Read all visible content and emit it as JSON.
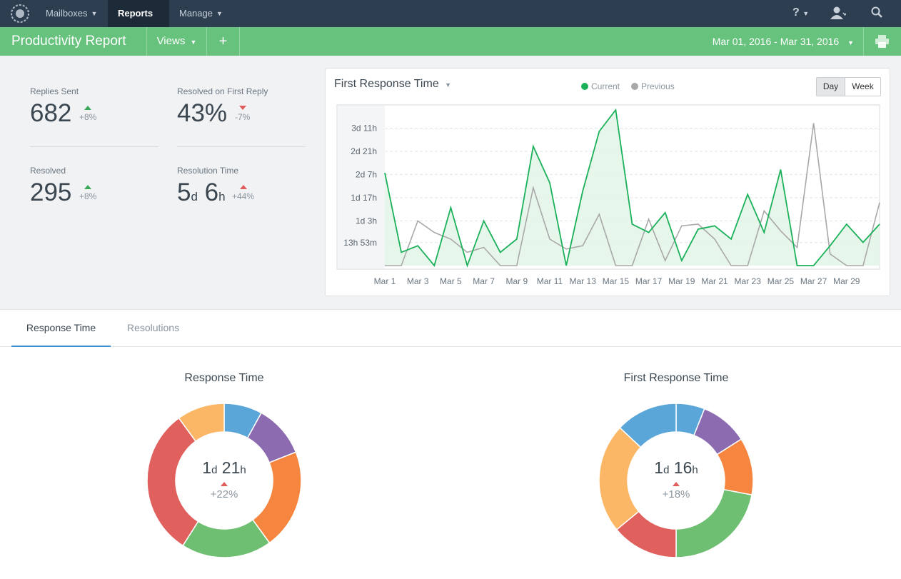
{
  "nav": {
    "mailboxes": "Mailboxes",
    "reports": "Reports",
    "manage": "Manage",
    "help_icon": "question-icon",
    "user_icon": "user-icon",
    "search_icon": "search-icon"
  },
  "subbar": {
    "title": "Productivity Report",
    "views": "Views",
    "add": "+",
    "date_range": "Mar 01, 2016 - Mar 31, 2016",
    "print_icon": "print-icon"
  },
  "stats": [
    {
      "label": "Replies Sent",
      "value": "682",
      "delta": "+8%",
      "trend": "up-good"
    },
    {
      "label": "Resolved on First Reply",
      "value": "43%",
      "delta": "-7%",
      "trend": "down-bad"
    },
    {
      "label": "Resolved",
      "value": "295",
      "delta": "+8%",
      "trend": "up-good"
    },
    {
      "label": "Resolution Time",
      "value_days": "5",
      "unit_d": "d",
      "value_hours": "6",
      "unit_h": "h",
      "delta": "+44%",
      "trend": "up-bad"
    }
  ],
  "chart": {
    "title": "First Response Time",
    "legend_current": "Current",
    "legend_previous": "Previous",
    "day": "Day",
    "week": "Week",
    "colors": {
      "current": "#1bb15a",
      "previous": "#a8a8a8",
      "fill": "#e3f4e8"
    }
  },
  "chart_data": {
    "type": "line",
    "x": [
      "Mar 1",
      "Mar 2",
      "Mar 3",
      "Mar 4",
      "Mar 5",
      "Mar 6",
      "Mar 7",
      "Mar 8",
      "Mar 9",
      "Mar 10",
      "Mar 11",
      "Mar 12",
      "Mar 13",
      "Mar 14",
      "Mar 15",
      "Mar 16",
      "Mar 17",
      "Mar 18",
      "Mar 19",
      "Mar 20",
      "Mar 21",
      "Mar 22",
      "Mar 23",
      "Mar 24",
      "Mar 25",
      "Mar 26",
      "Mar 27",
      "Mar 28",
      "Mar 29",
      "Mar 30",
      "Mar 31"
    ],
    "x_tick_labels": [
      "Mar 1",
      "Mar 3",
      "Mar 5",
      "Mar 7",
      "Mar 9",
      "Mar 11",
      "Mar 13",
      "Mar 15",
      "Mar 17",
      "Mar 19",
      "Mar 21",
      "Mar 23",
      "Mar 25",
      "Mar 27",
      "Mar 29"
    ],
    "y_tick_labels": [
      "13h 53m",
      "1d 3h",
      "1d 17h",
      "2d 7h",
      "2d 21h",
      "3d 11h"
    ],
    "y_tick_values": [
      13.88,
      27,
      41,
      55,
      69,
      83
    ],
    "ylim": [
      0,
      97
    ],
    "series": [
      {
        "name": "Current",
        "values": [
          56,
          8,
          12,
          0,
          35,
          0,
          27,
          8,
          16,
          72,
          50,
          0,
          45,
          81,
          94,
          25,
          20,
          32,
          3,
          22,
          24,
          16,
          43,
          20,
          58,
          0,
          0,
          12,
          25,
          14,
          25
        ]
      },
      {
        "name": "Previous",
        "values": [
          0,
          0,
          27,
          20,
          16,
          8,
          11,
          0,
          0,
          47,
          16,
          10,
          12,
          31,
          0,
          0,
          28,
          3,
          24,
          25,
          16,
          0,
          0,
          33,
          21,
          11,
          86,
          7,
          0,
          0,
          38
        ]
      }
    ]
  },
  "tabs": {
    "response_time": "Response Time",
    "resolutions": "Resolutions"
  },
  "donuts": [
    {
      "title": "Response Time",
      "value_days": "1",
      "unit_d": "d",
      "value_hours": "21",
      "unit_h": "h",
      "delta": "+22%",
      "slices": [
        {
          "value": 8,
          "color": "#5aa6d8"
        },
        {
          "value": 11,
          "color": "#8c6bb1"
        },
        {
          "value": 21,
          "color": "#f5853f"
        },
        {
          "value": 19,
          "color": "#6fbf73"
        },
        {
          "value": 31,
          "color": "#e0605e"
        },
        {
          "value": 10,
          "color": "#fbb666"
        }
      ]
    },
    {
      "title": "First Response Time",
      "value_days": "1",
      "unit_d": "d",
      "value_hours": "16",
      "unit_h": "h",
      "delta": "+18%",
      "slices": [
        {
          "value": 6,
          "color": "#5aa6d8"
        },
        {
          "value": 10,
          "color": "#8c6bb1"
        },
        {
          "value": 12,
          "color": "#f5853f"
        },
        {
          "value": 22,
          "color": "#6fbf73"
        },
        {
          "value": 14,
          "color": "#e0605e"
        },
        {
          "value": 23,
          "color": "#fbb666"
        },
        {
          "value": 13,
          "color": "#5aa6d8"
        }
      ]
    }
  ]
}
